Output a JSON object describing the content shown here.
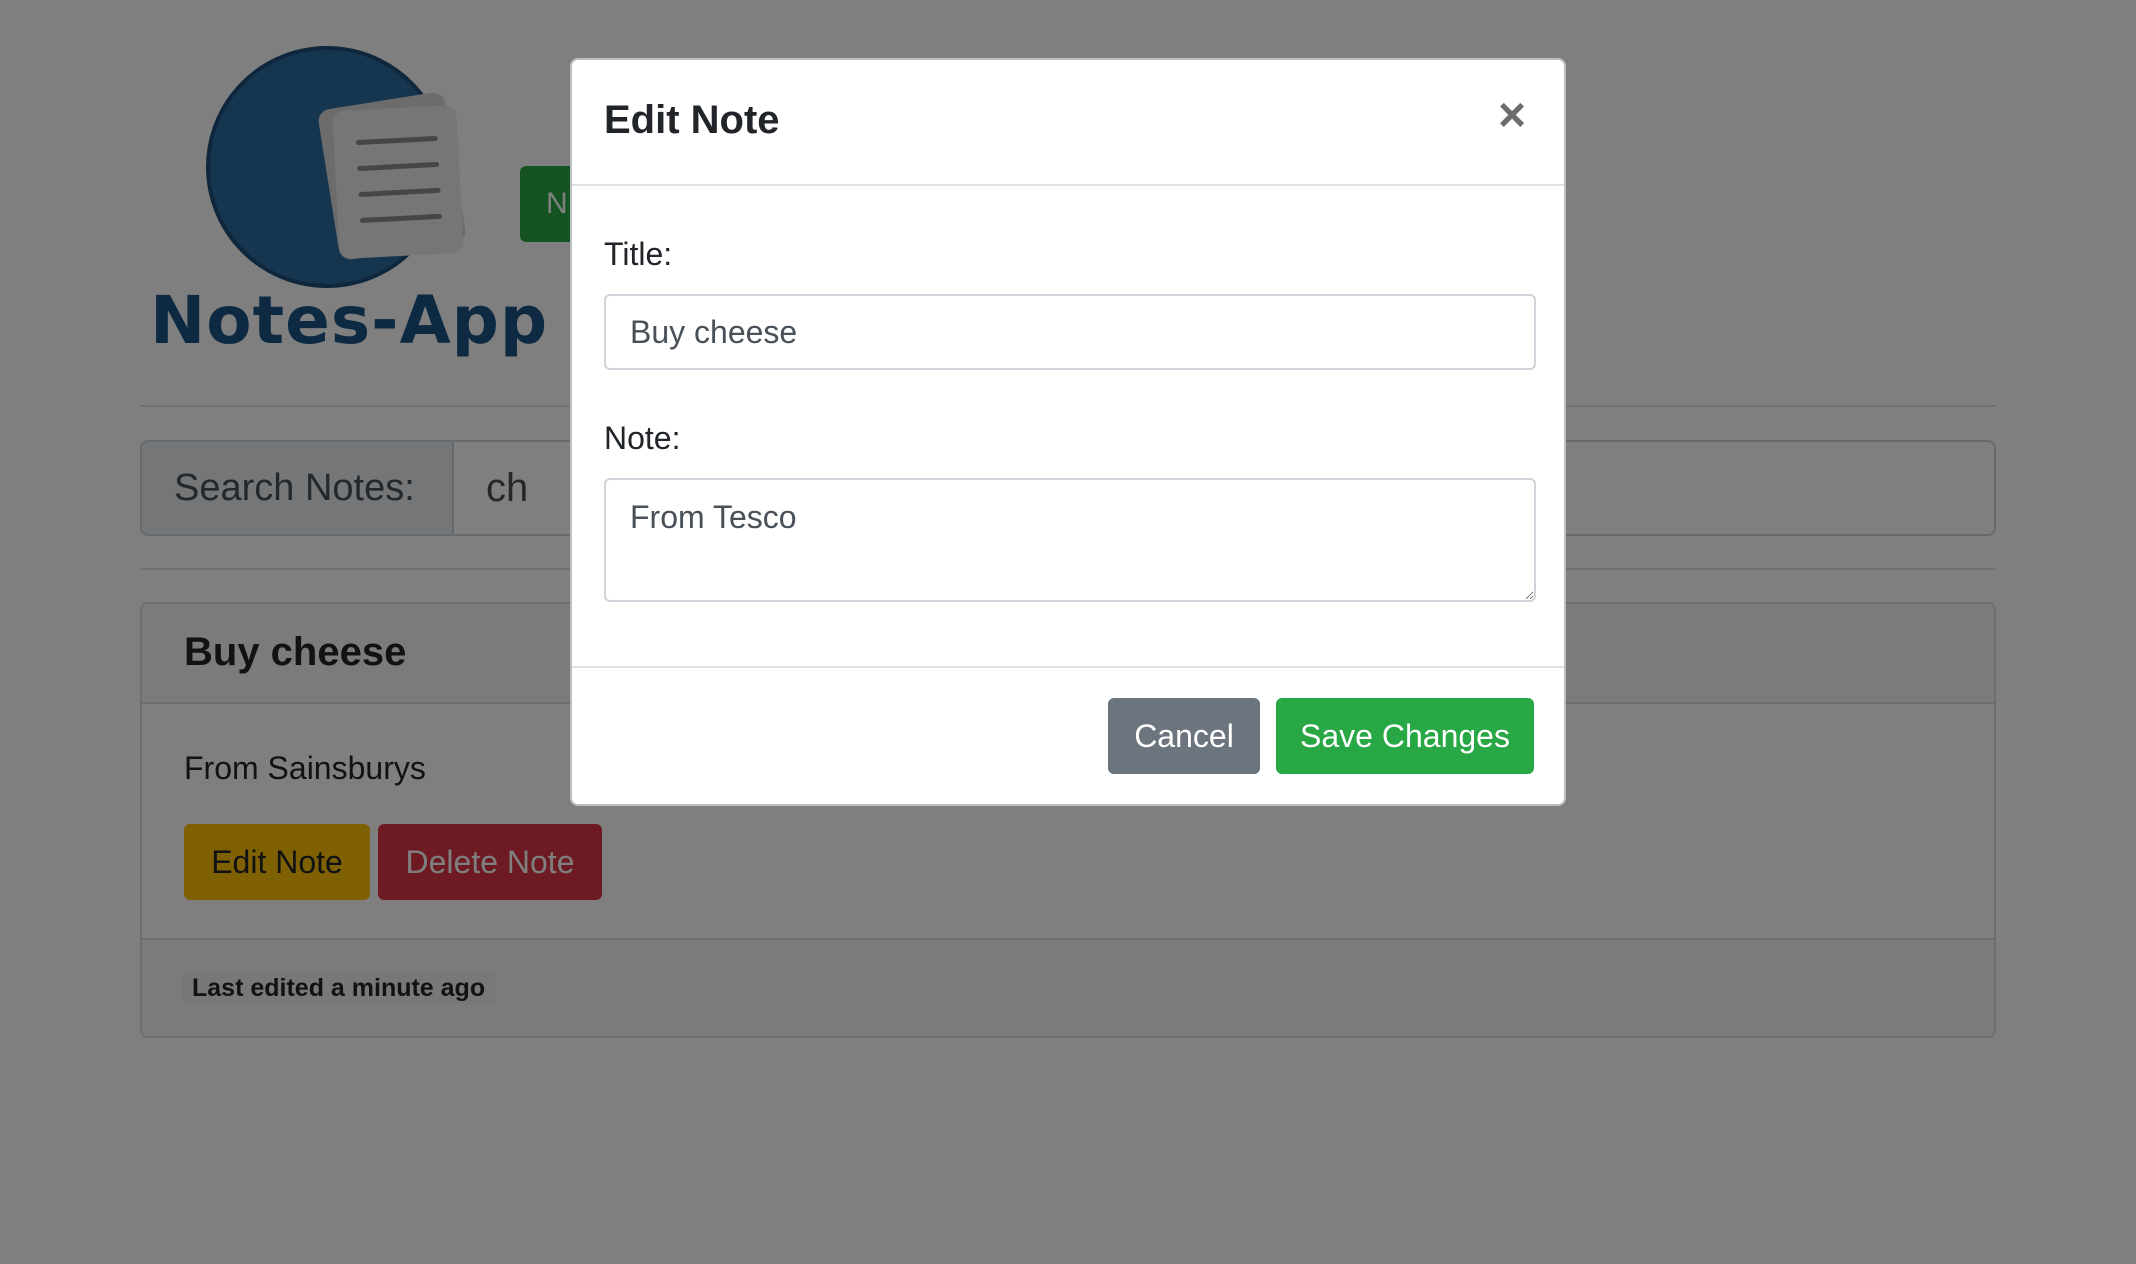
{
  "app": {
    "logo_text": "Notes-App",
    "new_note_label": "N"
  },
  "search": {
    "label": "Search Notes:",
    "value": "ch"
  },
  "notes": [
    {
      "title": "Buy cheese",
      "body": "From Sainsburys",
      "edit_label": "Edit Note",
      "delete_label": "Delete Note",
      "timestamp": "Last edited a minute ago"
    }
  ],
  "modal": {
    "title": "Edit Note",
    "close_glyph": "×",
    "title_label": "Title:",
    "title_value": "Buy cheese",
    "note_label": "Note:",
    "note_value": "From Tesco",
    "cancel_label": "Cancel",
    "save_label": "Save Changes"
  },
  "colors": {
    "primary_green": "#28a745",
    "warning_yellow": "#ffc107",
    "danger_red": "#dc3545",
    "secondary_gray": "#6c757d",
    "logo_blue": "#1a5584"
  },
  "icons": {
    "logo": "notes-paper-icon",
    "close": "close-icon"
  }
}
